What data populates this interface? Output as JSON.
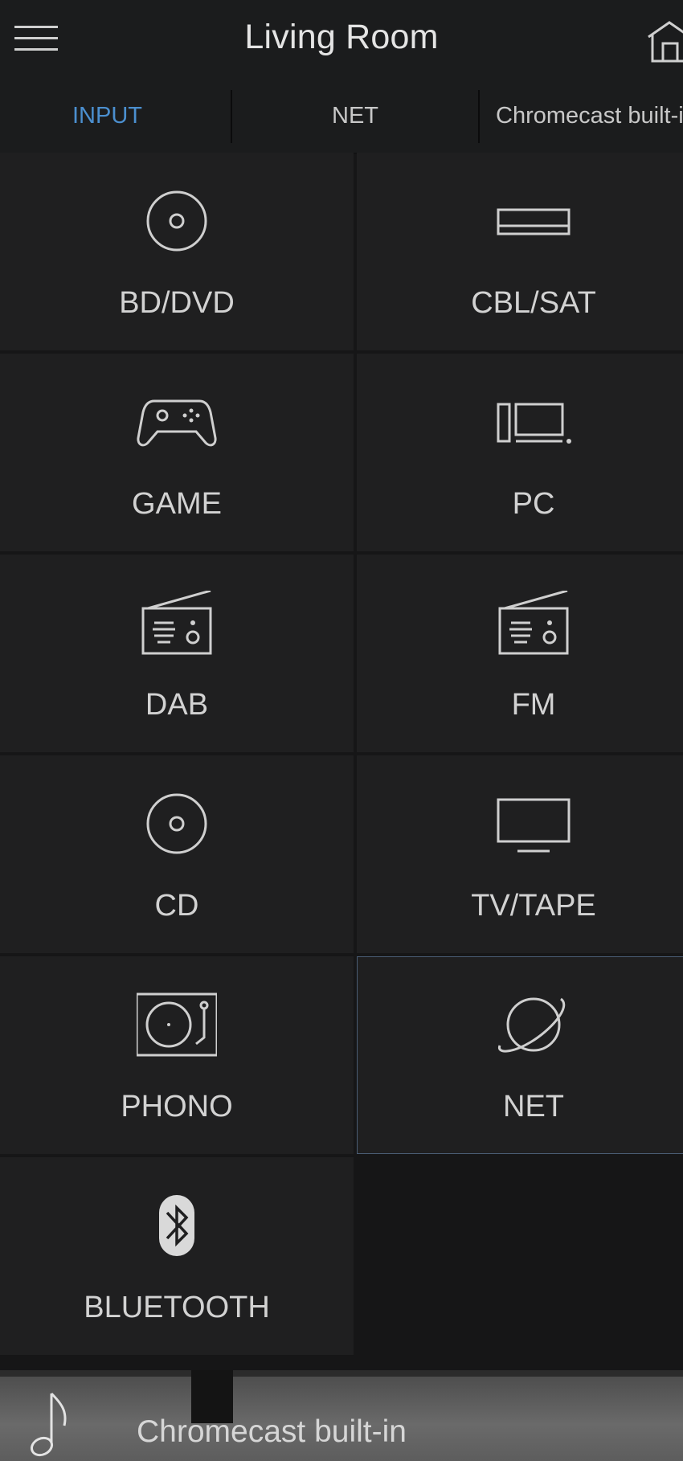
{
  "header": {
    "title": "Living Room",
    "menu_icon": "hamburger-menu-icon",
    "home_icon": "home-icon"
  },
  "tabs": [
    {
      "label": "INPUT",
      "active": true
    },
    {
      "label": "NET",
      "active": false
    },
    {
      "label": "Chromecast built-in",
      "active": false
    }
  ],
  "inputs": [
    {
      "label": "BD/DVD",
      "icon": "disc-icon"
    },
    {
      "label": "CBL/SAT",
      "icon": "set-top-box-icon"
    },
    {
      "label": "GAME",
      "icon": "gamepad-icon"
    },
    {
      "label": "PC",
      "icon": "computer-icon"
    },
    {
      "label": "DAB",
      "icon": "radio-icon"
    },
    {
      "label": "FM",
      "icon": "radio-icon"
    },
    {
      "label": "CD",
      "icon": "disc-icon"
    },
    {
      "label": "TV/TAPE",
      "icon": "tv-icon"
    },
    {
      "label": "PHONO",
      "icon": "turntable-icon"
    },
    {
      "label": "NET",
      "icon": "globe-icon",
      "selected": true
    },
    {
      "label": "BLUETOOTH",
      "icon": "bluetooth-icon"
    }
  ],
  "now_playing": {
    "label": "Chromecast built-in",
    "icon": "music-note-icon"
  },
  "colors": {
    "accent": "#4b8fcf",
    "background": "#161617",
    "tile": "#1f1f20",
    "text": "#d2d2d2"
  }
}
